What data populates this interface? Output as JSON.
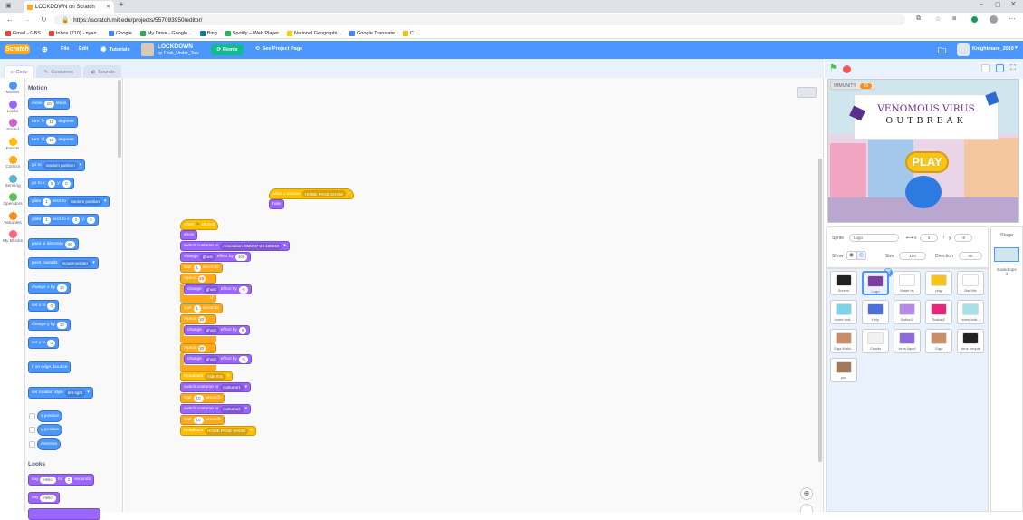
{
  "browser": {
    "tab_title": "LOCKDOWN on Scratch",
    "url": "https://scratch.mit.edu/projects/557093950/editor/",
    "bookmarks": [
      "Gmail - GBS",
      "Inbox (710) - riyan...",
      "Google",
      "My Drive - Google...",
      "Bing",
      "Spotify – Web Player",
      "National Geographi...",
      "Google Translate",
      "C"
    ],
    "bookmark_colors": [
      "#ea4335",
      "#ea4335",
      "#4285f4",
      "#34a853",
      "#00809d",
      "#1db954",
      "#ffce00",
      "#4285f4",
      "#fbbc04"
    ]
  },
  "menu": {
    "logo": "Scratch",
    "file": "File",
    "edit": "Edit",
    "tutorials": "Tutorials",
    "project_title": "LOCKDOWN",
    "project_author": "by Frisk_Under_Tale",
    "remix": "Remix",
    "see_project": "See Project Page",
    "username": "Knightmare_2010"
  },
  "tabs": {
    "code": "Code",
    "costumes": "Costumes",
    "sounds": "Sounds"
  },
  "categories": [
    {
      "label": "Motion",
      "color": "#4c97ff"
    },
    {
      "label": "Looks",
      "color": "#9966ff"
    },
    {
      "label": "Sound",
      "color": "#cf63cf"
    },
    {
      "label": "Events",
      "color": "#ffbf00"
    },
    {
      "label": "Control",
      "color": "#ffab19"
    },
    {
      "label": "Sensing",
      "color": "#5cb1d6"
    },
    {
      "label": "Operators",
      "color": "#59c059"
    },
    {
      "label": "Variables",
      "color": "#ff8c1a"
    },
    {
      "label": "My Blocks",
      "color": "#ff6680"
    }
  ],
  "palette": {
    "motion_header": "Motion",
    "move": "move",
    "move_val": "10",
    "steps": "steps",
    "turn": "turn",
    "turn_val": "15",
    "degrees": "degrees",
    "goto": "go to",
    "goto_dd": "random position",
    "goto_xy": "go to x:",
    "gx": "0",
    "y_lbl": "y:",
    "gy": "0",
    "glide": "glide",
    "glide_val": "1",
    "secs_to": "secs to",
    "glide_dd": "random position",
    "glide_xy": "secs to x:",
    "gx2": "0",
    "gy2": "0",
    "point_dir": "point in direction",
    "point_val": "90",
    "point_towards": "point towards",
    "point_dd": "mouse-pointer",
    "change_x": "change x by",
    "cx": "10",
    "set_x": "set x to",
    "sx": "0",
    "change_y": "change y by",
    "cy": "10",
    "set_y": "set y to",
    "sy": "0",
    "bounce": "if on edge, bounce",
    "rot_style": "set rotation style",
    "rot_dd": "left-right",
    "xpos": "x position",
    "ypos": "y position",
    "direction": "direction",
    "looks_header": "Looks",
    "say": "say",
    "say_val": "Hello!",
    "for": "for",
    "say_secs": "2",
    "seconds": "seconds",
    "say2": "say",
    "say2_val": "Hello!"
  },
  "scripts": {
    "when_receive": "when I receive",
    "receive_dd": "HOME PAGE SHOW",
    "hide": "hide",
    "when_flag": "when",
    "clicked": "clicked",
    "show": "show",
    "switch_costume": "switch costume to",
    "costume_dd1": "Annotation 2020-07-24 180248",
    "change": "change",
    "ghost": "ghost",
    "effect_by": "effect by",
    "ghost_val": "100",
    "wait": "wait",
    "wait1": "1",
    "seconds": "seconds",
    "repeat": "repeat",
    "repeat1": "20",
    "ghost_step": "-5",
    "wait2": "1",
    "repeat2": "20",
    "ghost_step2": "5",
    "repeat3": "20",
    "ghost_step3": "-5",
    "broadcast": "broadcast",
    "bc1": "hide this",
    "costume_dd2": "costume1",
    "wait3": "10",
    "costume_dd3": "costume2",
    "wait4": "10",
    "bc2": "HOME PAGE SHOW"
  },
  "stage": {
    "variable_label": "IMMUNITY",
    "variable_value": "85",
    "title1": "VENOMOUS VIRUS",
    "title2": "OUTBREAK",
    "play": "PLAY"
  },
  "sprite_info": {
    "sprite_label": "Sprite",
    "sprite_name": "Logo",
    "x_label": "x",
    "x_val": "3",
    "y_label": "y",
    "y_val": "-8",
    "show_label": "Show",
    "size_label": "Size",
    "size_val": "100",
    "direction_label": "Direction",
    "direction_val": "90"
  },
  "sprites": [
    {
      "name": "Screen",
      "color": "#222222"
    },
    {
      "name": "Logo",
      "color": "#7a3fa0",
      "selected": true
    },
    {
      "name": "Made by",
      "color": "#ffffff"
    },
    {
      "name": "play",
      "color": "#f7c21a"
    },
    {
      "name": "Bad life",
      "color": "#ffffff"
    },
    {
      "name": "home butt...",
      "color": "#7fd3e6"
    },
    {
      "name": "Help",
      "color": "#4c6fd9"
    },
    {
      "name": "Button2",
      "color": "#b38ae6"
    },
    {
      "name": "Button2",
      "color": "#e6287a"
    },
    {
      "name": "home butt...",
      "color": "#a8e0ea"
    },
    {
      "name": "Giga Walki...",
      "color": "#c98d6a"
    },
    {
      "name": "Clouds",
      "color": "#f1f1f1"
    },
    {
      "name": "virus liquid",
      "color": "#8c6bd6"
    },
    {
      "name": "Giga",
      "color": "#c98d6a"
    },
    {
      "name": "virus people",
      "color": "#222222"
    },
    {
      "name": "you",
      "color": "#a0785a"
    }
  ],
  "stage_panel": {
    "label": "Stage",
    "backdrops_label": "Backdrops",
    "backdrops_count": "3"
  }
}
